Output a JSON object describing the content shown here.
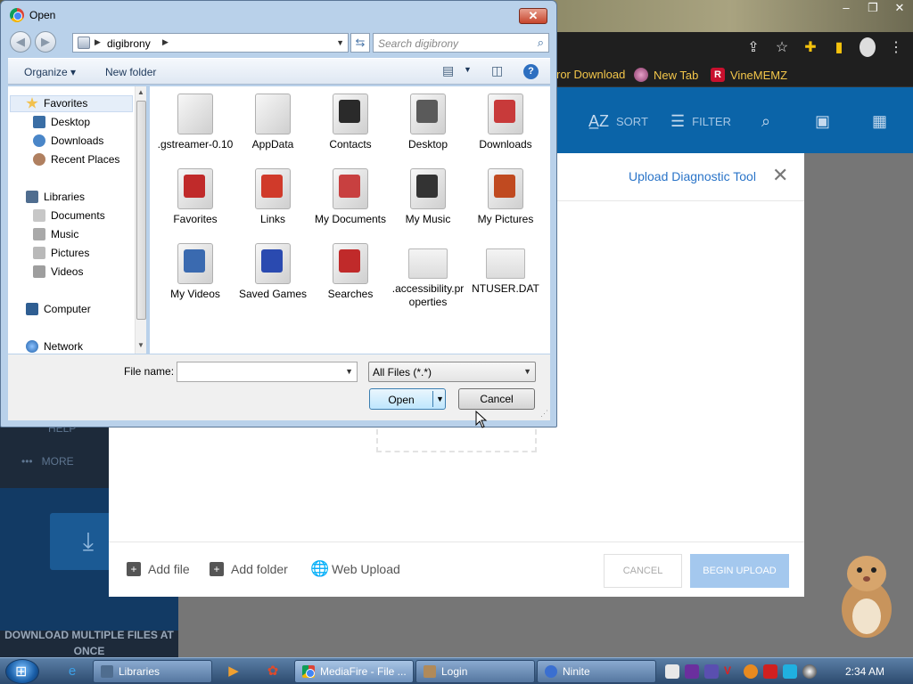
{
  "dialog": {
    "title": "Open",
    "address_path": "digibrony",
    "search_placeholder": "Search digibrony",
    "organize_label": "Organize",
    "new_folder_label": "New folder",
    "nav_pane": {
      "favorites_label": "Favorites",
      "favorites": [
        "Desktop",
        "Downloads",
        "Recent Places"
      ],
      "libraries_label": "Libraries",
      "libraries": [
        "Documents",
        "Music",
        "Pictures",
        "Videos"
      ],
      "computer_label": "Computer",
      "network_label": "Network"
    },
    "files": [
      {
        "name": ".gstreamer-0.10",
        "icon": "folder-icon"
      },
      {
        "name": "AppData",
        "icon": "folder-icon"
      },
      {
        "name": "Contacts",
        "icon": "contacts-folder-icon"
      },
      {
        "name": "Desktop",
        "icon": "desktop-folder-icon"
      },
      {
        "name": "Downloads",
        "icon": "downloads-folder-icon"
      },
      {
        "name": "Favorites",
        "icon": "favorites-folder-icon"
      },
      {
        "name": "Links",
        "icon": "links-folder-icon"
      },
      {
        "name": "My Documents",
        "icon": "documents-folder-icon"
      },
      {
        "name": "My Music",
        "icon": "music-folder-icon"
      },
      {
        "name": "My Pictures",
        "icon": "pictures-folder-icon"
      },
      {
        "name": "My Videos",
        "icon": "videos-folder-icon"
      },
      {
        "name": "Saved Games",
        "icon": "games-folder-icon"
      },
      {
        "name": "Searches",
        "icon": "searches-folder-icon"
      },
      {
        "name": ".accessibility.properties",
        "icon": "file-icon"
      },
      {
        "name": "NTUSER.DAT",
        "icon": "file-icon"
      }
    ],
    "file_name_label": "File name:",
    "file_name_value": "",
    "file_type_value": "All Files (*.*)",
    "open_label": "Open",
    "cancel_label": "Cancel"
  },
  "browser": {
    "bookmarks": [
      "ror Download",
      "New Tab",
      "VineMEMZ"
    ],
    "toolbar": {
      "sort_label": "SORT",
      "filter_label": "FILTER"
    },
    "sidebar": {
      "help_label": "HELP",
      "more_label": "MORE",
      "download_promo": "DOWNLOAD MULTIPLE FILES AT ONCE"
    }
  },
  "upload": {
    "diagnostic_link": "Upload Diagnostic Tool",
    "add_file_label": "Add file",
    "add_folder_label": "Add folder",
    "web_upload_label": "Web Upload",
    "cancel_label": "CANCEL",
    "begin_label": "BEGIN UPLOAD"
  },
  "taskbar": {
    "buttons": [
      "Libraries",
      "MediaFire - File ...",
      "Login",
      "Ninite"
    ],
    "clock": "2:34 AM"
  },
  "colors": {
    "accent": "#0b64a8",
    "dialog_frame": "#b9d1ea",
    "begin_upload": "#a4c8ee"
  }
}
